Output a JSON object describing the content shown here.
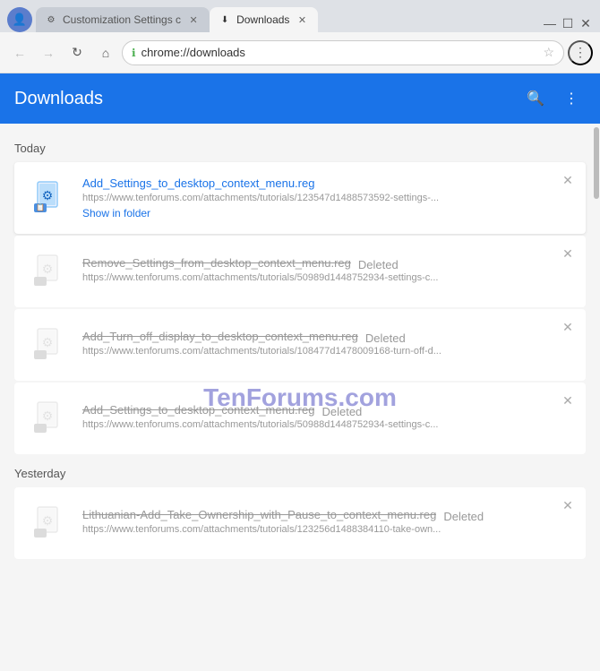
{
  "titlebar": {
    "tabs": [
      {
        "id": "tab-customization",
        "label": "Customization Settings c",
        "favicon": "⚙",
        "active": false
      },
      {
        "id": "tab-downloads",
        "label": "Downloads",
        "favicon": "↓",
        "active": true
      }
    ],
    "controls": {
      "minimize": "—",
      "maximize": "☐",
      "close": "✕"
    }
  },
  "omnibar": {
    "back_disabled": true,
    "forward_disabled": true,
    "url": "chrome://downloads",
    "url_icon": "🔒"
  },
  "downloads_page": {
    "title": "Downloads",
    "search_label": "search",
    "menu_label": "menu",
    "watermark": "TenForums.com",
    "sections": [
      {
        "label": "Today",
        "items": [
          {
            "filename": "Add_Settings_to_desktop_context_menu.reg",
            "url": "https://www.tenforums.com/attachments/tutorials/123547d1488573592-settings-...",
            "action": "Show in folder",
            "deleted": false,
            "active": true
          },
          {
            "filename": "Remove_Settings_from_desktop_context_menu.reg",
            "url": "https://www.tenforums.com/attachments/tutorials/50989d1448752934-settings-c...",
            "deleted": true,
            "deleted_label": "Deleted",
            "active": false
          },
          {
            "filename": "Add_Turn_off_display_to_desktop_context_menu.reg",
            "url": "https://www.tenforums.com/attachments/tutorials/108477d1478009168-turn-off-d...",
            "deleted": true,
            "deleted_label": "Deleted",
            "active": false
          },
          {
            "filename": "Add_Settings_to_desktop_context_menu.reg",
            "url": "https://www.tenforums.com/attachments/tutorials/50988d1448752934-settings-c...",
            "deleted": true,
            "deleted_label": "Deleted",
            "active": false
          }
        ]
      },
      {
        "label": "Yesterday",
        "items": [
          {
            "filename": "Lithuanian-Add_Take_Ownership_with_Pause_to_context_menu.reg",
            "url": "https://www.tenforums.com/attachments/tutorials/123256d1488384110-take-own...",
            "deleted": true,
            "deleted_label": "Deleted",
            "active": false
          }
        ]
      }
    ]
  }
}
